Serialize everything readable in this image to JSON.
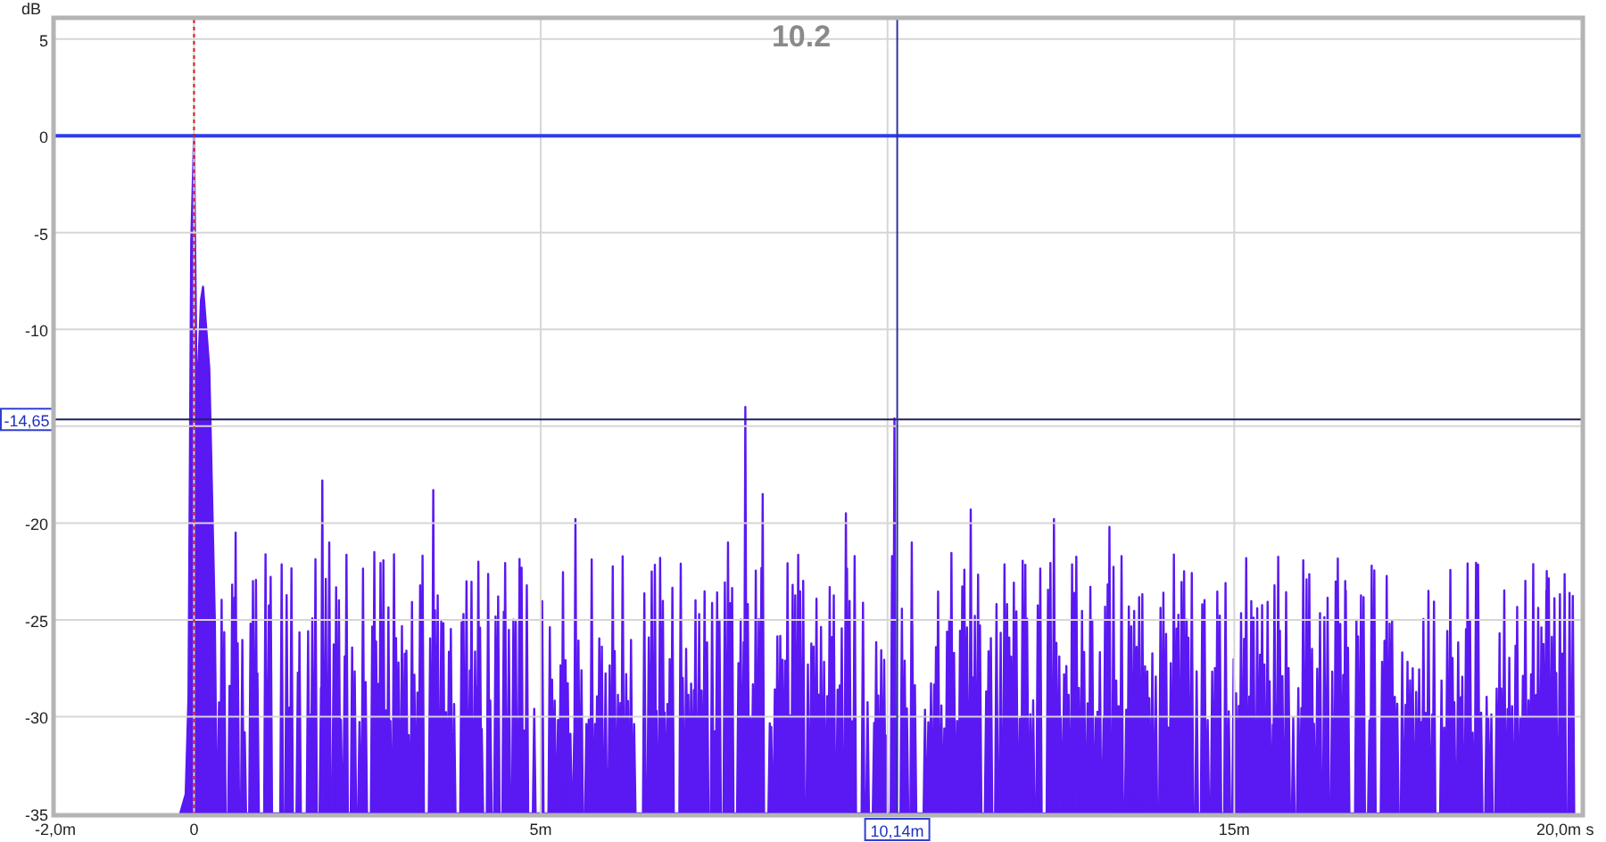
{
  "chart_data": {
    "type": "line",
    "title": "10.2",
    "xlabel": "s",
    "ylabel": "dB",
    "xlim": [
      -2,
      20
    ],
    "ylim": [
      -35,
      6
    ],
    "grid": true,
    "xticks": [
      {
        "value": -2,
        "label": "-2,0m"
      },
      {
        "value": 0,
        "label": "0"
      },
      {
        "value": 5,
        "label": "5m"
      },
      {
        "value": 15,
        "label": "15m"
      },
      {
        "value": 20,
        "label": "20,0m"
      }
    ],
    "yticks": [
      {
        "value": 5,
        "label": "5"
      },
      {
        "value": 0,
        "label": "0"
      },
      {
        "value": -5,
        "label": "-5"
      },
      {
        "value": -10,
        "label": "-10"
      },
      {
        "value": -20,
        "label": "-20"
      },
      {
        "value": -25,
        "label": "-25"
      },
      {
        "value": -30,
        "label": "-30"
      },
      {
        "value": -35,
        "label": "-35"
      }
    ],
    "ref_lines": [
      {
        "axis": "y",
        "value": 0,
        "color": "#2f3ee8"
      },
      {
        "axis": "x",
        "value": 0,
        "color": "#d02020"
      },
      {
        "axis": "y",
        "value": -14.65,
        "color": "#202060",
        "label": "-14,65"
      },
      {
        "axis": "x",
        "value": 10.14,
        "color": "#3030a0",
        "label": "10,14m"
      }
    ]
  }
}
